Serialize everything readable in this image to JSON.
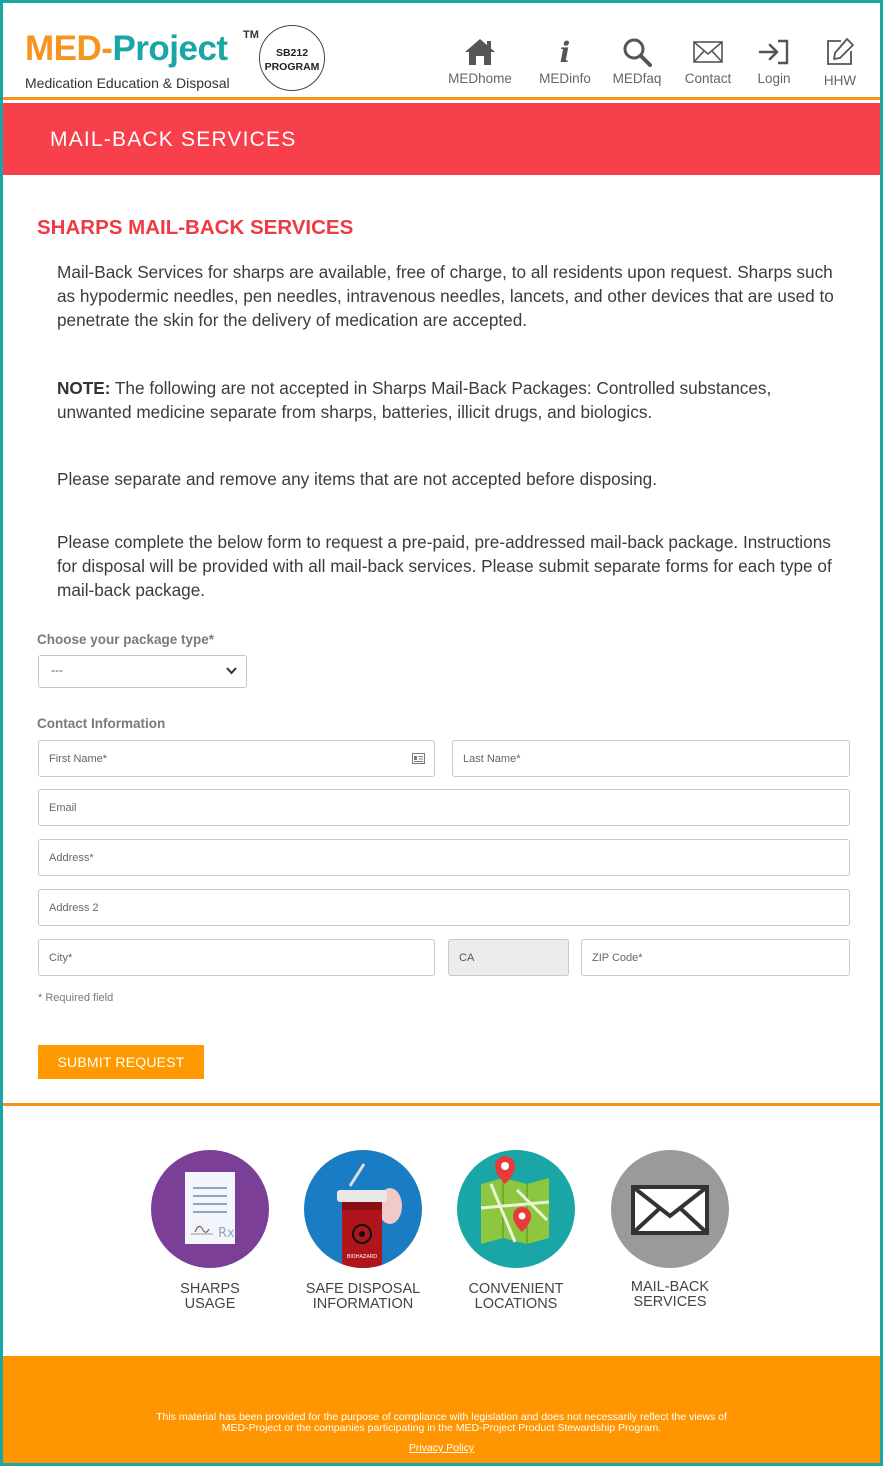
{
  "header": {
    "logo_med": "MED-",
    "logo_project": "Project",
    "logo_tm": "TM",
    "logo_subtitle": "Medication Education & Disposal",
    "badge_line1": "SB212",
    "badge_line2": "PROGRAM",
    "nav": [
      {
        "label": "MEDhome",
        "icon": "home-icon"
      },
      {
        "label": "MEDinfo",
        "icon": "info-icon"
      },
      {
        "label": "MEDfaq",
        "icon": "search-icon"
      },
      {
        "label": "Contact",
        "icon": "envelope-icon"
      },
      {
        "label": "Login",
        "icon": "login-icon"
      },
      {
        "label": "HHW",
        "icon": "edit-icon"
      }
    ]
  },
  "banner": {
    "title": "MAIL-BACK SERVICES"
  },
  "content": {
    "title": "SHARPS MAIL-BACK SERVICES",
    "para1": "Mail-Back Services for sharps are available, free of charge, to all residents upon request. Sharps such as hypodermic needles, pen needles, intravenous needles, lancets, and other devices that are used to penetrate the skin for the delivery of medication are accepted.",
    "note_label": "NOTE:",
    "note_text": " The following are not accepted in Sharps Mail-Back Packages: Controlled substances, unwanted medicine separate from sharps, batteries, illicit drugs, and biologics.",
    "para3": "Please separate and remove any items that are not accepted before disposing.",
    "para4": "Please complete the below form to request a pre-paid, pre-addressed mail-back package. Instructions for disposal will be provided with all mail-back services. Please submit separate forms for each type of mail-back package."
  },
  "form": {
    "package_label": "Choose your package type*",
    "package_value": "---",
    "contact_label": "Contact Information",
    "first_name": "First Name*",
    "last_name": "Last Name*",
    "email": "Email",
    "address": "Address*",
    "address2": "Address 2",
    "city": "City*",
    "state": "CA",
    "zip": "ZIP Code*",
    "required_note": "* Required field",
    "submit": "SUBMIT REQUEST"
  },
  "footer_links": [
    {
      "line1": "SHARPS",
      "line2": "USAGE",
      "color": "#7b3f97"
    },
    {
      "line1": "SAFE DISPOSAL",
      "line2": "INFORMATION",
      "color": "#1a7dc4"
    },
    {
      "line1": "CONVENIENT",
      "line2": "LOCATIONS",
      "color": "#1aa6a6"
    },
    {
      "line1": "MAIL-BACK",
      "line2": "SERVICES",
      "color": "#9a9a9a"
    }
  ],
  "footer": {
    "disclaimer_line1": "This material has been provided for the purpose of compliance with legislation and does not necessarily reflect the views of",
    "disclaimer_line2": "MED-Project or the companies participating in the MED-Project Product Stewardship Program.",
    "privacy": "Privacy Policy"
  },
  "colors": {
    "teal": "#1aa6a6",
    "orange": "#f7941d",
    "banner_red": "#f8404d",
    "title_red": "#ee3a45",
    "submit_orange": "#ff9900"
  }
}
